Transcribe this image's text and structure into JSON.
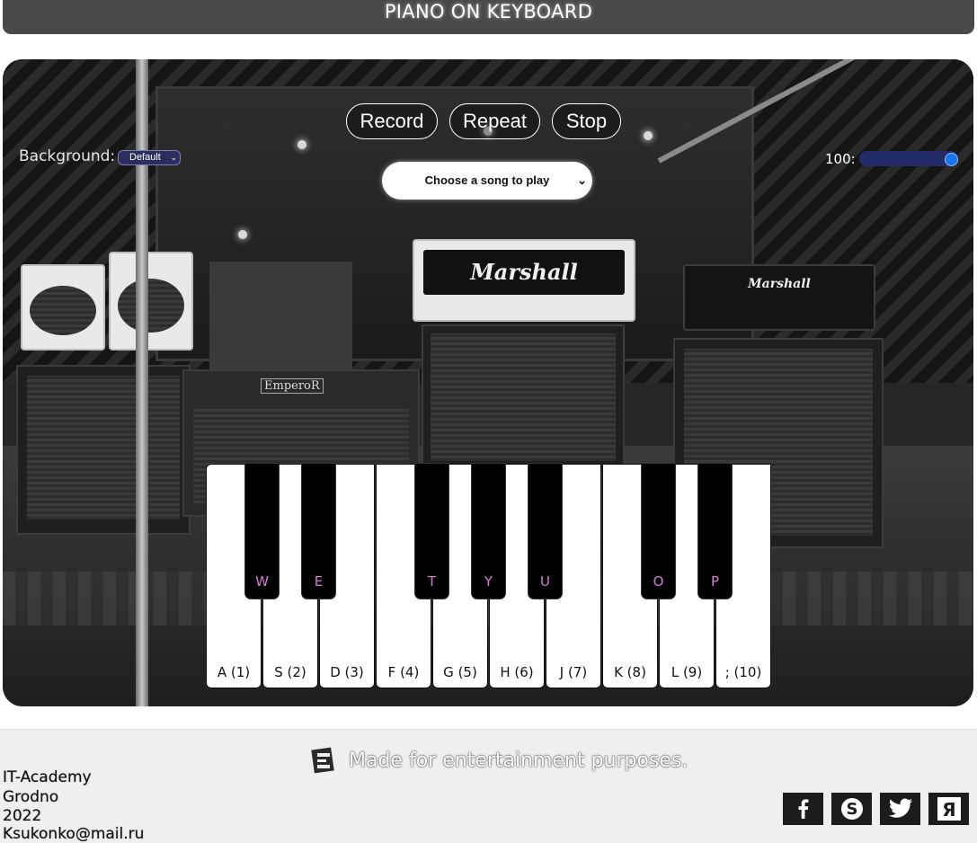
{
  "header": {
    "title": "PIANO ON KEYBOARD"
  },
  "controls": {
    "record_label": "Record",
    "repeat_label": "Repeat",
    "stop_label": "Stop",
    "background_label": "Background:",
    "background_value": "Default",
    "song_placeholder": "Choose a song to play",
    "volume_label": "100:",
    "volume_value": 100
  },
  "piano": {
    "white_keys": [
      "A (1)",
      "S (2)",
      "D (3)",
      "F (4)",
      "G (5)",
      "H (6)",
      "J (7)",
      "K (8)",
      "L (9)",
      "; (10)"
    ],
    "black_keys": [
      "W",
      "E",
      "T",
      "Y",
      "U",
      "O",
      "P"
    ]
  },
  "footer": {
    "message": "Made for entertainment purposes.",
    "info": [
      "IT-Academy",
      "Grodno",
      "2022",
      "Ksukonko@mail.ru"
    ],
    "social": [
      "facebook-icon",
      "skype-icon",
      "twitter-icon",
      "yandex-icon"
    ]
  },
  "colors": {
    "header_bg": "#494949",
    "key_label_black": "#d47bd6",
    "volume_track": "#2b2f6e",
    "volume_thumb": "#1a73e8",
    "footer_bg": "#efefef"
  }
}
